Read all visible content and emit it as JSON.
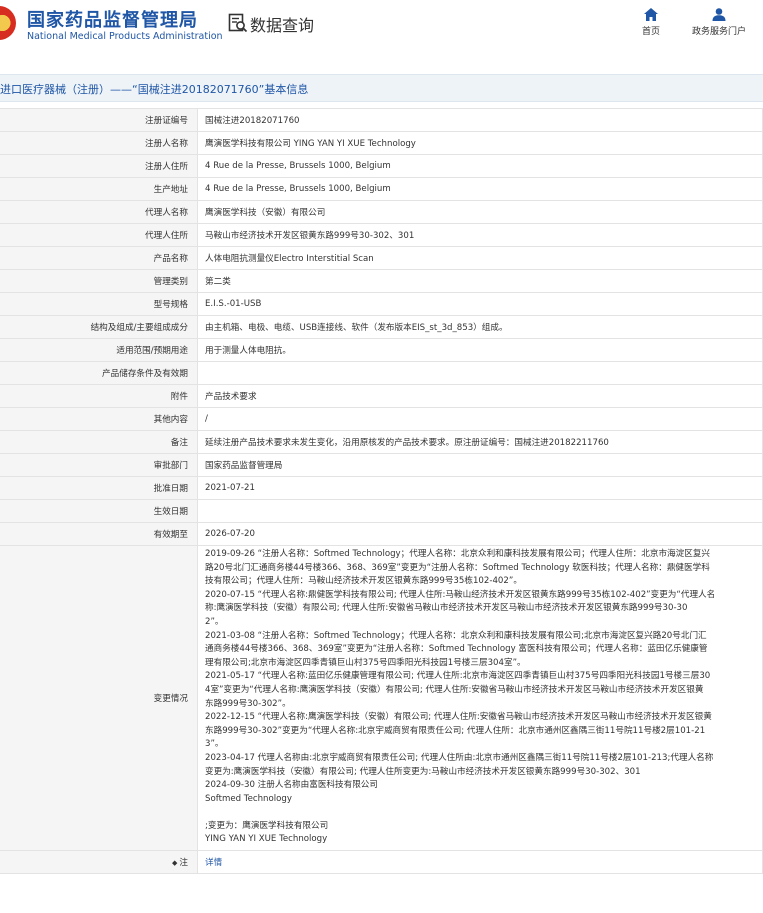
{
  "header": {
    "logo_cn": "国家药品监督管理局",
    "logo_en": "National Medical Products Administration",
    "query_title": "数据查询",
    "nav": [
      {
        "label": "首页",
        "icon": "home-icon"
      },
      {
        "label": "政务服务门户",
        "icon": "user-icon"
      }
    ]
  },
  "title": "进口医疗器械（注册）——“国械注进20182071760”基本信息",
  "rows": [
    {
      "label": "注册证编号",
      "value": "国械注进20182071760"
    },
    {
      "label": "注册人名称",
      "value": "鹰演医学科技有限公司 YING YAN YI XUE Technology"
    },
    {
      "label": "注册人住所",
      "value": "4 Rue de la Presse, Brussels 1000, Belgium"
    },
    {
      "label": "生产地址",
      "value": "4 Rue de la Presse, Brussels 1000, Belgium"
    },
    {
      "label": "代理人名称",
      "value": "鹰演医学科技（安徽）有限公司"
    },
    {
      "label": "代理人住所",
      "value": "马鞍山市经济技术开发区银黄东路999号30-302、301"
    },
    {
      "label": "产品名称",
      "value": "人体电阻抗测量仪Electro Interstitial Scan"
    },
    {
      "label": "管理类别",
      "value": "第二类"
    },
    {
      "label": "型号规格",
      "value": "E.I.S.-01-USB"
    },
    {
      "label": "结构及组成/主要组成成分",
      "value": "由主机箱、电极、电缆、USB连接线、软件（发布版本EIS_st_3d_853）组成。"
    },
    {
      "label": "适用范围/预期用途",
      "value": "用于测量人体电阻抗。"
    },
    {
      "label": "产品储存条件及有效期",
      "value": ""
    },
    {
      "label": "附件",
      "value": "产品技术要求"
    },
    {
      "label": "其他内容",
      "value": "/"
    },
    {
      "label": "备注",
      "value": "延续注册产品技术要求未发生变化，沿用原核发的产品技术要求。原注册证编号：国械注进20182211760"
    },
    {
      "label": "审批部门",
      "value": "国家药品监督管理局"
    },
    {
      "label": "批准日期",
      "value": "2021-07-21"
    },
    {
      "label": "生效日期",
      "value": ""
    },
    {
      "label": "有效期至",
      "value": "2026-07-20"
    }
  ],
  "changes": {
    "label": "变更情况",
    "lines": [
      "2019-09-26 “注册人名称：Softmed Technology；代理人名称：北京众利和康科技发展有限公司；代理人住所：北京市海淀区复兴",
      "路20号北门汇通商务楼44号楼366、368、369室”变更为“注册人名称：Softmed Technology 软医科技；代理人名称：鼎健医学科",
      "技有限公司；代理人住所：马鞍山经济技术开发区银黄东路999号35栋102-402”。",
      "2020-07-15 “代理人名称:鼎健医学科技有限公司; 代理人住所:马鞍山经济技术开发区银黄东路999号35栋102-402”变更为“代理人名",
      "称:鹰演医学科技（安徽）有限公司; 代理人住所:安徽省马鞍山市经济技术开发区马鞍山市经济技术开发区银黄东路999号30-30",
      "2”。",
      "2021-03-08 “注册人名称：Softmed Technology；代理人名称：北京众利和康科技发展有限公司;北京市海淀区复兴路20号北门汇",
      "通商务楼44号楼366、368、369室”变更为“注册人名称：Softmed Technology 富医科技有限公司；代理人名称：蓝田亿乐健康管",
      "理有限公司;北京市海淀区四季青镇巨山村375号四季阳光科技园1号楼三层304室”。",
      "2021-05-17 “代理人名称:蓝田亿乐健康管理有限公司; 代理人住所:北京市海淀区四季青镇巨山村375号四季阳光科技园1号楼三层30",
      "4室”变更为“代理人名称:鹰演医学科技（安徽）有限公司; 代理人住所:安徽省马鞍山市经济技术开发区马鞍山市经济技术开发区银黄",
      "东路999号30-302”。",
      "2022-12-15 “代理人名称:鹰演医学科技（安徽）有限公司; 代理人住所:安徽省马鞍山市经济技术开发区马鞍山市经济技术开发区银黄",
      "东路999号30-302”变更为“代理人名称:北京宇威商贸有限责任公司; 代理人住所：北京市通州区鑫隅三街11号院11号楼2层101-21",
      "3”。",
      "2023-04-17 代理人名称由:北京宇威商贸有限责任公司; 代理人住所由:北京市通州区鑫隅三街11号院11号楼2层101-213;代理人名称",
      "变更为:鹰演医学科技（安徽）有限公司; 代理人住所变更为:马鞍山市经济技术开发区银黄东路999号30-302、301",
      "2024-09-30 注册人名称由富医科技有限公司",
      "Softmed Technology",
      "",
      ";变更为：鹰演医学科技有限公司",
      "YING YAN YI XUE Technology"
    ]
  },
  "note": {
    "label": "注",
    "value": "详情"
  }
}
